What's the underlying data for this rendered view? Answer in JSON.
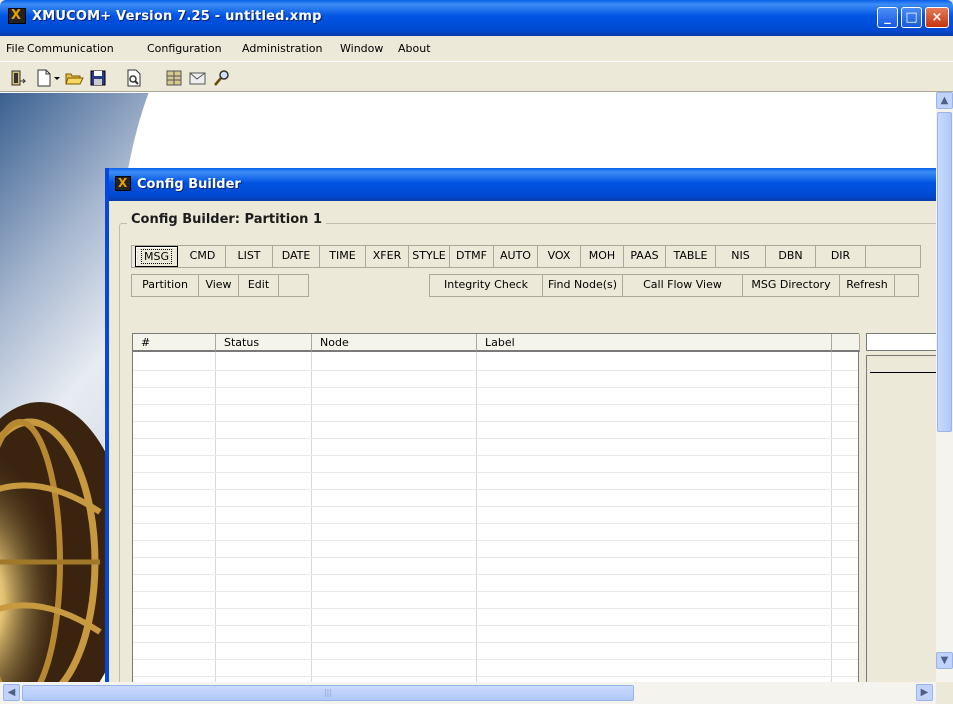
{
  "window": {
    "title": "XMUCOM+ Version 7.25 - untitled.xmp",
    "min_label": "_",
    "max_label": "□",
    "close_label": "×"
  },
  "menu": {
    "items": [
      "File",
      "Communication",
      "Configuration",
      "Administration",
      "Window",
      "About"
    ]
  },
  "toolbar": {
    "icons": [
      "exit-icon",
      "new-icon",
      "dropdown-arrow-icon",
      "open-folder-icon",
      "save-icon",
      "print-preview-icon",
      "settings-grid-icon",
      "message-icon",
      "search-icon"
    ]
  },
  "child": {
    "title": "Config Builder",
    "group_label": "Config Builder: Partition 1",
    "node_types": [
      "MSG",
      "CMD",
      "LIST",
      "DATE",
      "TIME",
      "XFER",
      "STYLE",
      "DTMF",
      "AUTO",
      "VOX",
      "MOH",
      "PAAS",
      "TABLE",
      "NIS",
      "DBN",
      "DIR"
    ],
    "actions_left": [
      "Partition",
      "View",
      "Edit"
    ],
    "actions_right": [
      "Integrity Check",
      "Find Node(s)",
      "Call Flow View",
      "MSG Directory",
      "Refresh"
    ],
    "grid": {
      "columns": [
        "#",
        "Status",
        "Node",
        "Label"
      ]
    }
  },
  "colors": {
    "titlebar": "#0054e3",
    "face": "#ece9d8",
    "close": "#c2350d"
  }
}
